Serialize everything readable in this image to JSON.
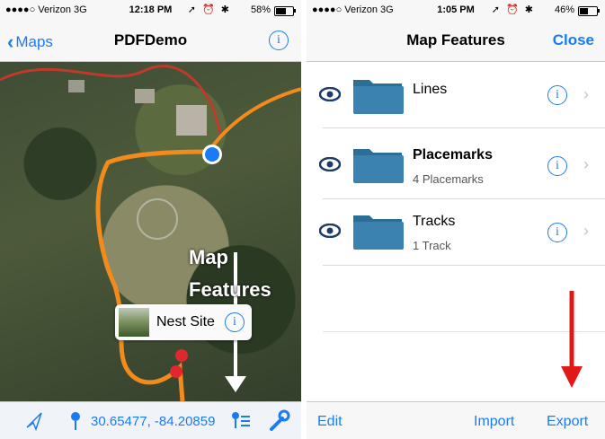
{
  "left_screen": {
    "status": {
      "carrier": "●●●●○ Verizon  3G",
      "time": "12:18 PM",
      "battery": "58%",
      "battery_level": 0.58
    },
    "nav": {
      "back_label": "Maps",
      "title": "PDFDemo"
    },
    "map": {
      "annotation_line1": "Map",
      "annotation_line2": "Features",
      "callout_label": "Nest Site"
    },
    "toolbar": {
      "coordinates": "30.65477, -84.20859"
    }
  },
  "right_screen": {
    "status": {
      "carrier": "●●●●○ Verizon  3G",
      "time": "1:05 PM",
      "battery": "46%",
      "battery_level": 0.46
    },
    "nav": {
      "title": "Map Features",
      "close_label": "Close"
    },
    "rows": [
      {
        "name": "Lines",
        "subtitle": "",
        "bold": false
      },
      {
        "name": "Placemarks",
        "subtitle": "4 Placemarks",
        "bold": true
      },
      {
        "name": "Tracks",
        "subtitle": "1 Track",
        "bold": false
      }
    ],
    "toolbar": {
      "edit_label": "Edit",
      "import_label": "Import",
      "export_label": "Export"
    }
  },
  "colors": {
    "accent": "#1a7cf5",
    "track": "#f28a1c",
    "user_location": "#1a7cf5",
    "pin": "#e0262e",
    "arrow_red": "#e11818",
    "arrow_white": "#ffffff"
  },
  "icons": [
    "location-arrow-icon",
    "pin-icon",
    "pin-list-icon",
    "wrench-icon",
    "eye-icon",
    "folder-icon",
    "info-icon",
    "chevron-right-icon"
  ]
}
